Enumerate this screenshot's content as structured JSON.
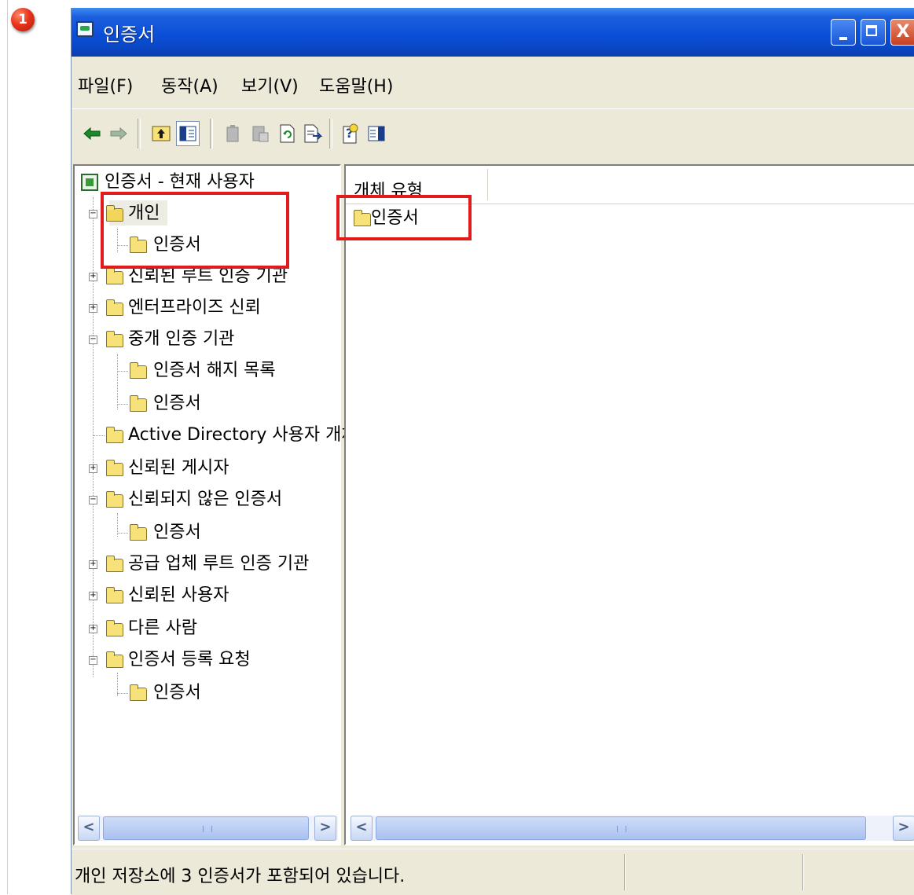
{
  "step_badge": "1",
  "window": {
    "title": "인증서",
    "min_label": "_",
    "max_label": "□",
    "close_label": "X"
  },
  "menu": [
    {
      "label": "파일(F)"
    },
    {
      "label": "동작(A)"
    },
    {
      "label": "보기(V)"
    },
    {
      "label": "도움말(H)"
    }
  ],
  "toolbar": {
    "icons": [
      "back-arrow-icon",
      "forward-arrow-icon",
      "up-one-level-icon",
      "show-hide-tree-icon",
      "delete-icon",
      "properties-icon",
      "refresh-icon",
      "export-list-icon",
      "help-icon",
      "show-hide-action-pane-icon"
    ]
  },
  "tree": {
    "root": "인증서 - 현재 사용자",
    "items": [
      {
        "label": "개인"
      },
      {
        "label": "인증서"
      },
      {
        "label": "신뢰된 루트 인증 기관"
      },
      {
        "label": "엔터프라이즈 신뢰"
      },
      {
        "label": "중개 인증 기관"
      },
      {
        "label": "인증서 해지 목록"
      },
      {
        "label": "인증서"
      },
      {
        "label": "Active Directory 사용자 개체"
      },
      {
        "label": "신뢰된 게시자"
      },
      {
        "label": "신뢰되지 않은 인증서"
      },
      {
        "label": "인증서"
      },
      {
        "label": "공급 업체 루트 인증 기관"
      },
      {
        "label": "신뢰된 사용자"
      },
      {
        "label": "다른 사람"
      },
      {
        "label": "인증서 등록 요청"
      },
      {
        "label": "인증서"
      }
    ]
  },
  "list": {
    "column_header": "개체 유형",
    "items": [
      {
        "label": "인증서"
      }
    ]
  },
  "scroll": {
    "left": "<",
    "right": ">"
  },
  "status": {
    "text": "개인 저장소에 3 인증서가 포함되어 있습니다."
  },
  "colors": {
    "titlebar": "#0b4fd8",
    "window_bg": "#ece9d8",
    "highlight": "#e01b1b",
    "folder": "#f7e27a"
  }
}
